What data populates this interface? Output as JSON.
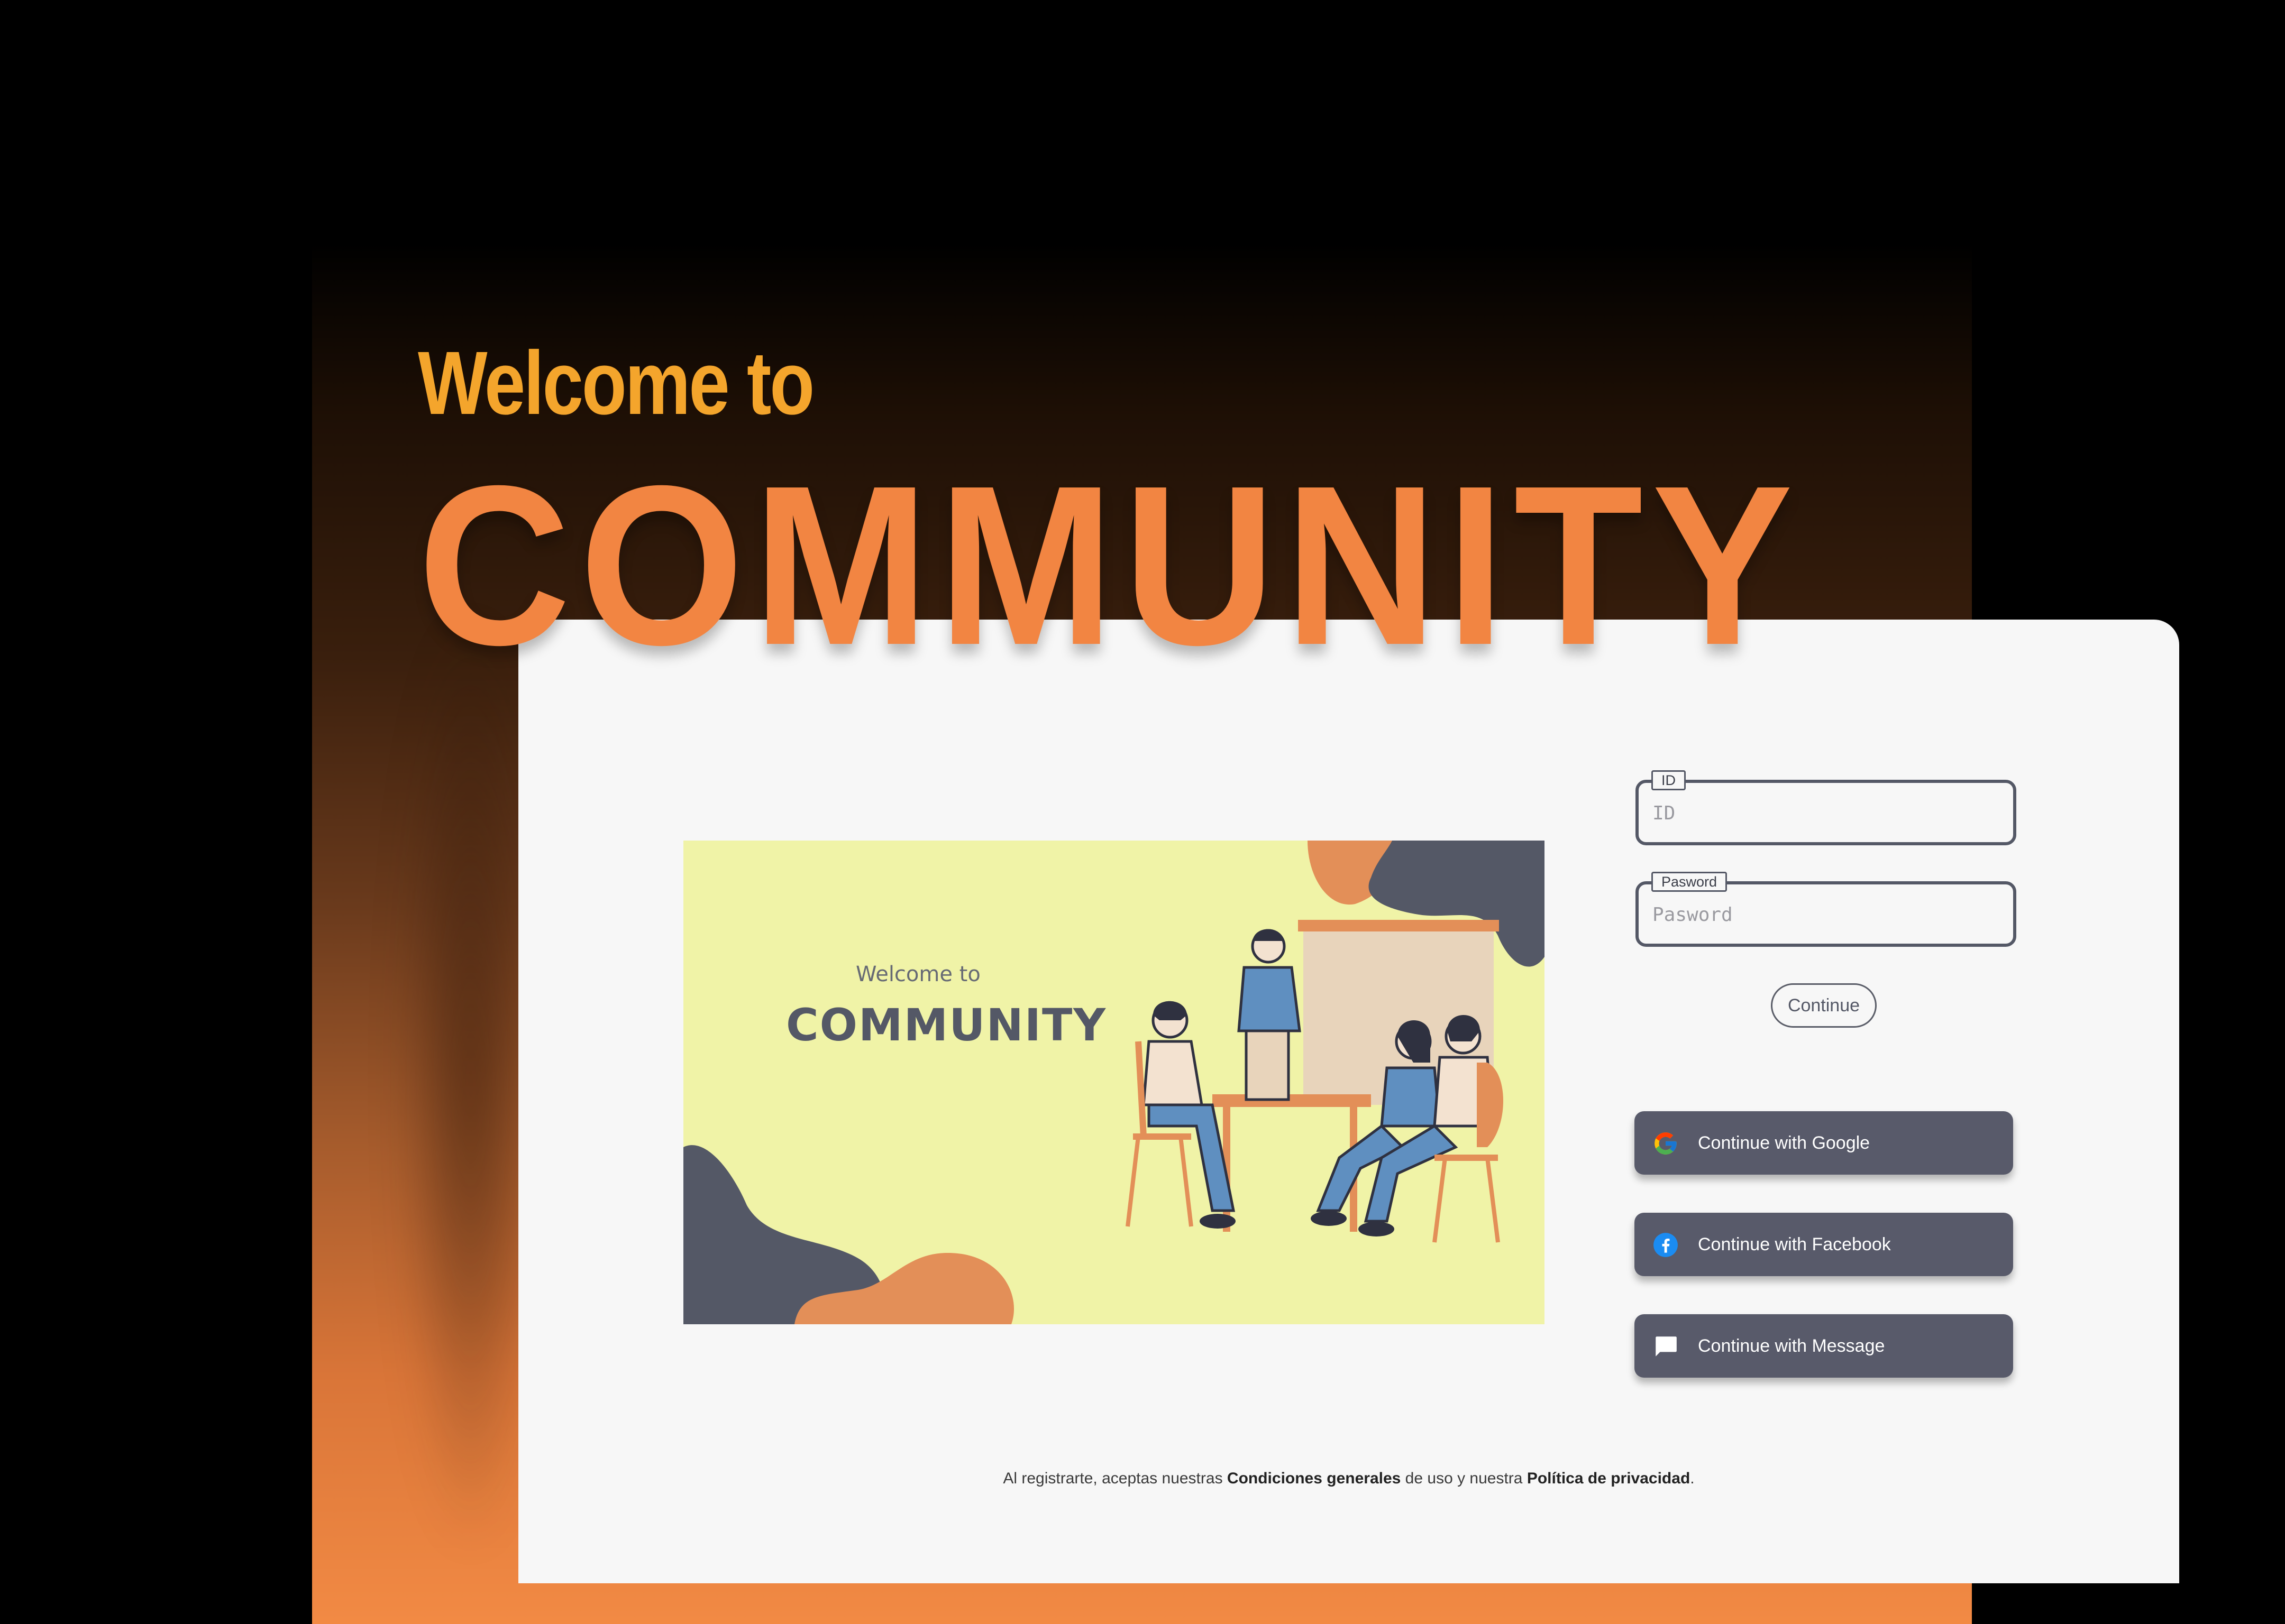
{
  "hero": {
    "welcome": "Welcome to",
    "title": "COMMUNITY"
  },
  "illustration": {
    "welcome": "Welcome to",
    "title": "COMMUNITY"
  },
  "form": {
    "id_label": "ID",
    "id_placeholder": "ID",
    "password_label": "Pasword",
    "password_placeholder": "Pasword",
    "continue_label": "Continue"
  },
  "social": {
    "google_label": "Continue with Google",
    "facebook_label": "Continue with Facebook",
    "message_label": "Continue with Message"
  },
  "legal": {
    "prefix": "Al registrarte, aceptas nuestras ",
    "terms": "Condiciones generales",
    "middle": " de uso y nuestra ",
    "privacy": "Política de privacidad",
    "suffix": "."
  },
  "colors": {
    "accent_orange": "#f28542",
    "welcome_yellow": "#f4a52c",
    "button_slate": "#585a6a",
    "card_bg": "#f7f7f7",
    "illustration_bg": "#f0f3a7"
  },
  "icons": [
    "google-icon",
    "facebook-icon",
    "message-icon"
  ]
}
